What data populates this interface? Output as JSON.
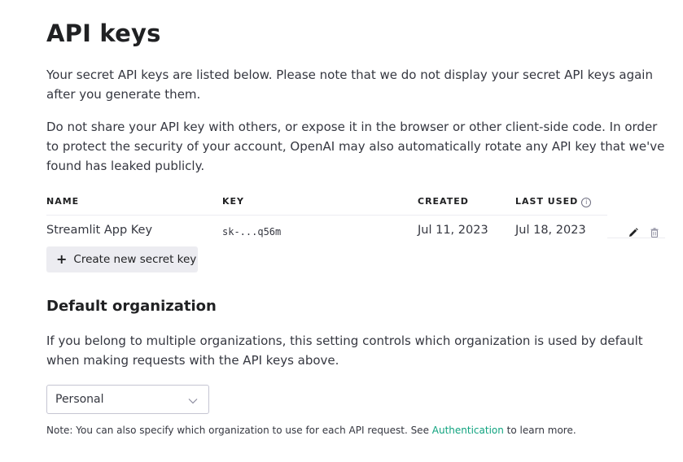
{
  "header": {
    "title": "API keys"
  },
  "intro": {
    "p1": "Your secret API keys are listed below. Please note that we do not display your secret API keys again after you generate them.",
    "p2": "Do not share your API key with others, or expose it in the browser or other client-side code. In order to protect the security of your account, OpenAI may also automatically rotate any API key that we've found has leaked publicly."
  },
  "table": {
    "columns": {
      "name": "NAME",
      "key": "KEY",
      "created": "CREATED",
      "last_used": "LAST USED",
      "info_glyph": "i"
    },
    "rows": [
      {
        "name": "Streamlit App Key",
        "key": "sk-...q56m",
        "created": "Jul 11, 2023",
        "last_used": "Jul 18, 2023"
      }
    ]
  },
  "actions": {
    "create_label": "Create new secret key",
    "plus_glyph": "+",
    "edit_icon": "pencil-icon",
    "delete_icon": "trash-icon"
  },
  "org": {
    "title": "Default organization",
    "description": "If you belong to multiple organizations, this setting controls which organization is used by default when making requests with the API keys above.",
    "selected": "Personal",
    "note_prefix": "Note: You can also specify which organization to use for each API request. See ",
    "note_link": "Authentication",
    "note_suffix": " to learn more."
  },
  "colors": {
    "text": "#353740",
    "heading": "#202123",
    "link": "#10a37f",
    "button_bg": "#ececf1",
    "border": "#c5c5d2"
  }
}
